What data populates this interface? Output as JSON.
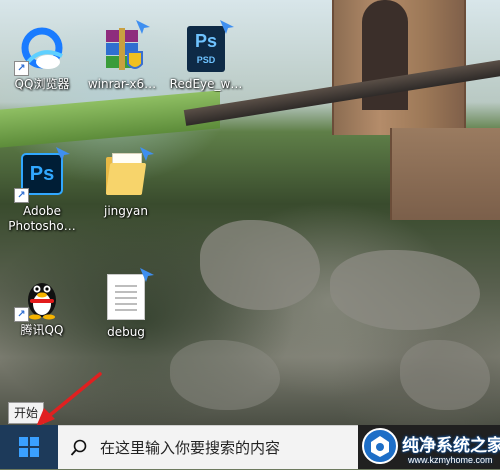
{
  "desktop": {
    "icons": [
      {
        "label": "QQ浏览器",
        "icon": "qq-browser-icon"
      },
      {
        "label": "winrar-x6…",
        "icon": "winrar-icon"
      },
      {
        "label": "RedEye_w…",
        "icon": "psd-file-icon",
        "badge": "PSD"
      },
      {
        "label": "Adobe Photosho…",
        "icon": "photoshop-icon",
        "badge": "Ps"
      },
      {
        "label": "jingyan",
        "icon": "folder-icon"
      },
      {
        "label": "腾讯QQ",
        "icon": "qq-penguin-icon"
      },
      {
        "label": "debug",
        "icon": "document-icon"
      }
    ]
  },
  "tooltip": {
    "text": "开始"
  },
  "taskbar": {
    "start_icon": "windows-logo-icon",
    "search": {
      "icon": "search-icon",
      "placeholder": "在这里输入你要搜索的内容"
    }
  },
  "watermark": {
    "title": "纯净系统之家",
    "url": "www.kzmyhome.com"
  },
  "colors": {
    "accent": "#2a6bd1",
    "arrow": "#e02020",
    "taskbar": "#202020",
    "ps_blue": "#31a8ff"
  }
}
